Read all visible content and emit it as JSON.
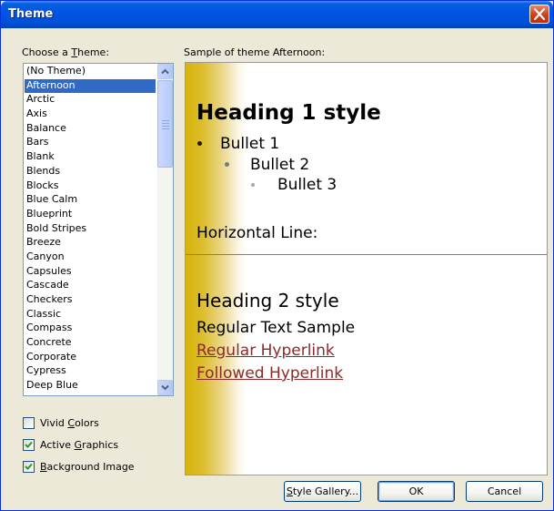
{
  "window": {
    "title": "Theme"
  },
  "theme_list": {
    "label_pre": "Choose a ",
    "label_key": "T",
    "label_post": "heme:",
    "selected": "Afternoon",
    "items": [
      "(No Theme)",
      "Afternoon",
      "Arctic",
      "Axis",
      "Balance",
      "Bars",
      "Blank",
      "Blends",
      "Blocks",
      "Blue Calm",
      "Blueprint",
      "Bold Stripes",
      "Breeze",
      "Canyon",
      "Capsules",
      "Cascade",
      "Checkers",
      "Classic",
      "Compass",
      "Concrete",
      "Corporate",
      "Cypress",
      "Deep Blue"
    ]
  },
  "options": {
    "vivid": {
      "label_pre": "Vivid ",
      "label_key": "C",
      "label_post": "olors",
      "checked": false
    },
    "active": {
      "label_pre": "Active ",
      "label_key": "G",
      "label_post": "raphics",
      "checked": true
    },
    "background": {
      "label_pre": "",
      "label_key": "B",
      "label_post": "ackground Image",
      "checked": true
    }
  },
  "preview": {
    "caption": "Sample of theme Afternoon:",
    "heading1": "Heading 1 style",
    "bullet1": "Bullet 1",
    "bullet2": "Bullet 2",
    "bullet3": "Bullet 3",
    "horizontal_line": "Horizontal Line:",
    "heading2": "Heading 2 style",
    "regular_text": "Regular Text Sample",
    "hyperlink": "Regular Hyperlink",
    "followed_hyperlink": "Followed Hyperlink"
  },
  "buttons": {
    "style_gallery_key": "S",
    "style_gallery_rest": "tyle Gallery...",
    "ok": "OK",
    "cancel": "Cancel"
  },
  "colors": {
    "titlebar": "#0054e3",
    "selection": "#316ac5",
    "hyperlink": "#8b2a2a",
    "preview_accent": "#d6b40a"
  },
  "icons": [
    "close-icon",
    "scroll-up-icon",
    "scroll-down-icon",
    "checkmark-icon",
    "bullet-icon"
  ]
}
